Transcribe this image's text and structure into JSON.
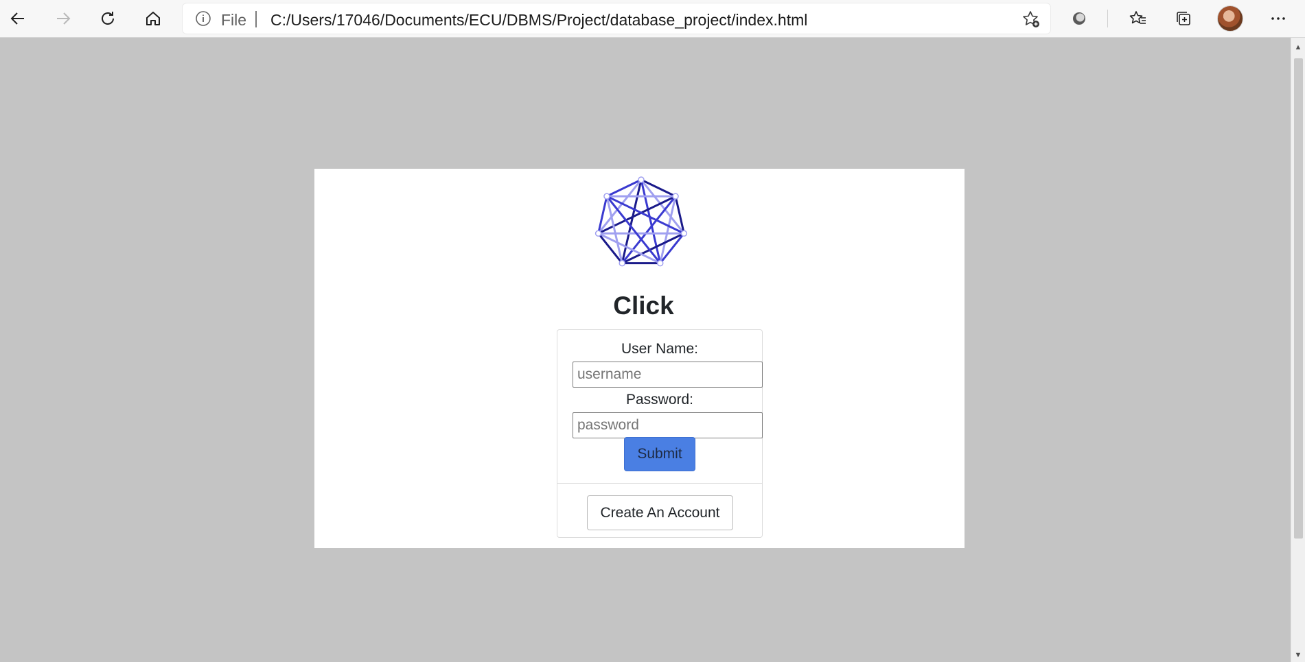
{
  "browser": {
    "address_scheme": "File",
    "address_url": "C:/Users/17046/Documents/ECU/DBMS/Project/database_project/index.html"
  },
  "page": {
    "app_title": "Click",
    "login": {
      "username_label": "User Name:",
      "username_placeholder": "username",
      "username_value": "",
      "password_label": "Password:",
      "password_placeholder": "password",
      "password_value": "",
      "submit_label": "Submit",
      "create_account_label": "Create An Account"
    }
  },
  "colors": {
    "page_background": "#c4c4c4",
    "submit_button": "#4a7fe3",
    "logo_dark": "#1a1a8a",
    "logo_mid": "#3a3ad0",
    "logo_light": "#a0a0f0"
  },
  "icons": {
    "back": "arrow-left-icon",
    "forward": "arrow-right-icon",
    "refresh": "refresh-icon",
    "home": "home-icon",
    "info": "info-icon",
    "add_favorite": "star-plus-icon",
    "extension": "extension-icon",
    "favorites": "favorites-icon",
    "collections": "collections-icon",
    "menu": "more-icon"
  }
}
